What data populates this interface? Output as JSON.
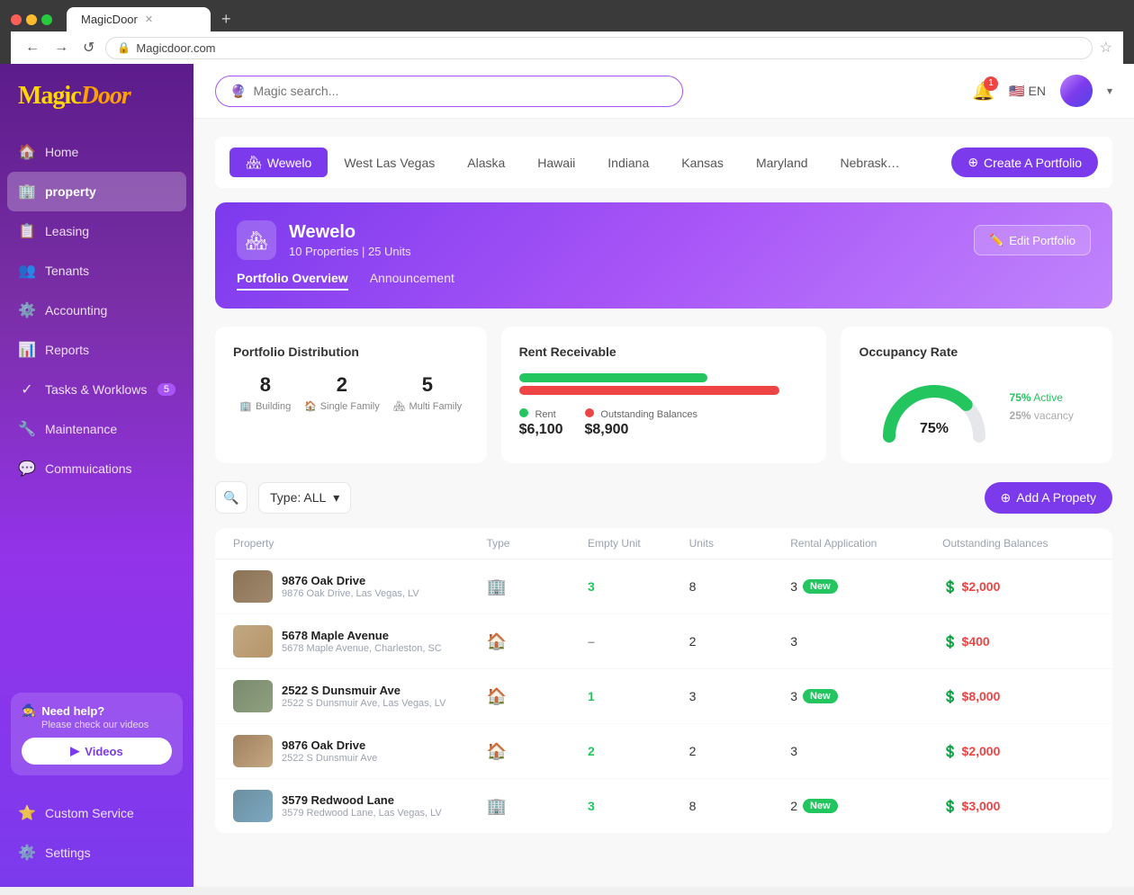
{
  "browser": {
    "tab_title": "MagicDoor",
    "url": "Magicdoor.com",
    "new_tab_icon": "+",
    "back_icon": "←",
    "forward_icon": "→",
    "refresh_icon": "↺",
    "lock_icon": "🔒"
  },
  "sidebar": {
    "logo": "MagicDoor",
    "nav_items": [
      {
        "id": "home",
        "label": "Home",
        "icon": "🏠",
        "active": false
      },
      {
        "id": "property",
        "label": "property",
        "icon": "🏢",
        "active": true
      },
      {
        "id": "leasing",
        "label": "Leasing",
        "icon": "📋",
        "active": false
      },
      {
        "id": "tenants",
        "label": "Tenants",
        "icon": "👥",
        "active": false
      },
      {
        "id": "accounting",
        "label": "Accounting",
        "icon": "⚙️",
        "active": false
      },
      {
        "id": "reports",
        "label": "Reports",
        "icon": "📊",
        "active": false
      },
      {
        "id": "tasks",
        "label": "Tasks & Worklows",
        "icon": "✓",
        "badge": "5",
        "active": false
      },
      {
        "id": "maintenance",
        "label": "Maintenance",
        "icon": "🔧",
        "active": false
      },
      {
        "id": "communications",
        "label": "Commuications",
        "icon": "💬",
        "active": false
      }
    ],
    "help": {
      "title": "Need help?",
      "subtitle": "Please check our videos",
      "btn_label": "Videos",
      "btn_icon": "▶"
    },
    "bottom_items": [
      {
        "id": "custom-service",
        "label": "Custom Service",
        "icon": "⭐"
      },
      {
        "id": "settings",
        "label": "Settings",
        "icon": "⚙️"
      }
    ]
  },
  "header": {
    "search_placeholder": "Magic search...",
    "search_icon": "🔮",
    "notifications_count": "1",
    "language": "EN",
    "dropdown_arrow": "▾"
  },
  "portfolio_tabs": {
    "tabs": [
      {
        "id": "wewelo",
        "label": "Wewelo",
        "active": true,
        "icon": "🏘"
      },
      {
        "id": "west-las-vegas",
        "label": "West Las Vegas",
        "active": false
      },
      {
        "id": "alaska",
        "label": "Alaska",
        "active": false
      },
      {
        "id": "hawaii",
        "label": "Hawaii",
        "active": false
      },
      {
        "id": "indiana",
        "label": "Indiana",
        "active": false
      },
      {
        "id": "kansas",
        "label": "Kansas",
        "active": false
      },
      {
        "id": "maryland",
        "label": "Maryland",
        "active": false
      },
      {
        "id": "nebraska",
        "label": "Nebrask…",
        "active": false
      }
    ],
    "create_btn": "Create A Portfolio",
    "create_icon": "+"
  },
  "portfolio_header": {
    "icon": "🏘",
    "name": "Wewelo",
    "properties_count": "10 Properties",
    "units_count": "25 Units",
    "edit_btn": "Edit Portfolio",
    "edit_icon": "✏️",
    "sub_tabs": [
      {
        "id": "overview",
        "label": "Portfolio Overview",
        "active": true
      },
      {
        "id": "announcement",
        "label": "Announcement",
        "active": false
      }
    ]
  },
  "stats": {
    "distribution": {
      "title": "Portfolio Distribution",
      "items": [
        {
          "value": "8",
          "label": "Building",
          "icon": "🏢"
        },
        {
          "value": "2",
          "label": "Single Family",
          "icon": "🏠"
        },
        {
          "value": "5",
          "label": "Multi Family",
          "icon": "🏘"
        }
      ]
    },
    "rent_receivable": {
      "title": "Rent Receivable",
      "rent_bar_width": "65%",
      "outstanding_bar_width": "90%",
      "legend": [
        {
          "label": "Rent",
          "color": "green",
          "amount": "$6,100"
        },
        {
          "label": "Outstanding Balances",
          "color": "red",
          "amount": "$8,900"
        }
      ]
    },
    "occupancy": {
      "title": "Occupancy Rate",
      "active_percent": "75%",
      "active_label": "Active",
      "vacancy_percent": "25%",
      "vacancy_label": "vacancy"
    }
  },
  "filter": {
    "type_label": "Type: ALL",
    "add_btn": "Add A Propety",
    "add_icon": "+"
  },
  "table": {
    "headers": [
      "Property",
      "Type",
      "Empty Unit",
      "Units",
      "Rental Application",
      "Outstanding Balances"
    ],
    "rows": [
      {
        "id": "row-1",
        "name": "9876 Oak Drive",
        "address": "9876 Oak Drive, Las Vegas, LV",
        "type_icon": "🏢",
        "empty_unit": "3",
        "units": "8",
        "rental_app": "3",
        "has_new_badge": true,
        "balance": "$2,000",
        "thumb_class": "thumb-1"
      },
      {
        "id": "row-2",
        "name": "5678 Maple Avenue",
        "address": "5678 Maple Avenue, Charleston, SC",
        "type_icon": "🏠",
        "empty_unit": "–",
        "units": "2",
        "rental_app": "3",
        "has_new_badge": false,
        "balance": "$400",
        "thumb_class": "thumb-2"
      },
      {
        "id": "row-3",
        "name": "2522 S Dunsmuir Ave",
        "address": "2522 S Dunsmuir Ave, Las Vegas, LV",
        "type_icon": "🏠",
        "empty_unit": "1",
        "units": "3",
        "rental_app": "3",
        "has_new_badge": true,
        "balance": "$8,000",
        "thumb_class": "thumb-3"
      },
      {
        "id": "row-4",
        "name": "9876 Oak Drive",
        "address": "2522 S Dunsmuir Ave",
        "type_icon": "🏠",
        "empty_unit": "2",
        "units": "2",
        "rental_app": "3",
        "has_new_badge": false,
        "balance": "$2,000",
        "thumb_class": "thumb-4"
      },
      {
        "id": "row-5",
        "name": "3579 Redwood Lane",
        "address": "3579 Redwood Lane, Las Vegas, LV",
        "type_icon": "🏢",
        "empty_unit": "3",
        "units": "8",
        "rental_app": "2",
        "has_new_badge": true,
        "balance": "$3,000",
        "thumb_class": "thumb-5"
      }
    ]
  }
}
